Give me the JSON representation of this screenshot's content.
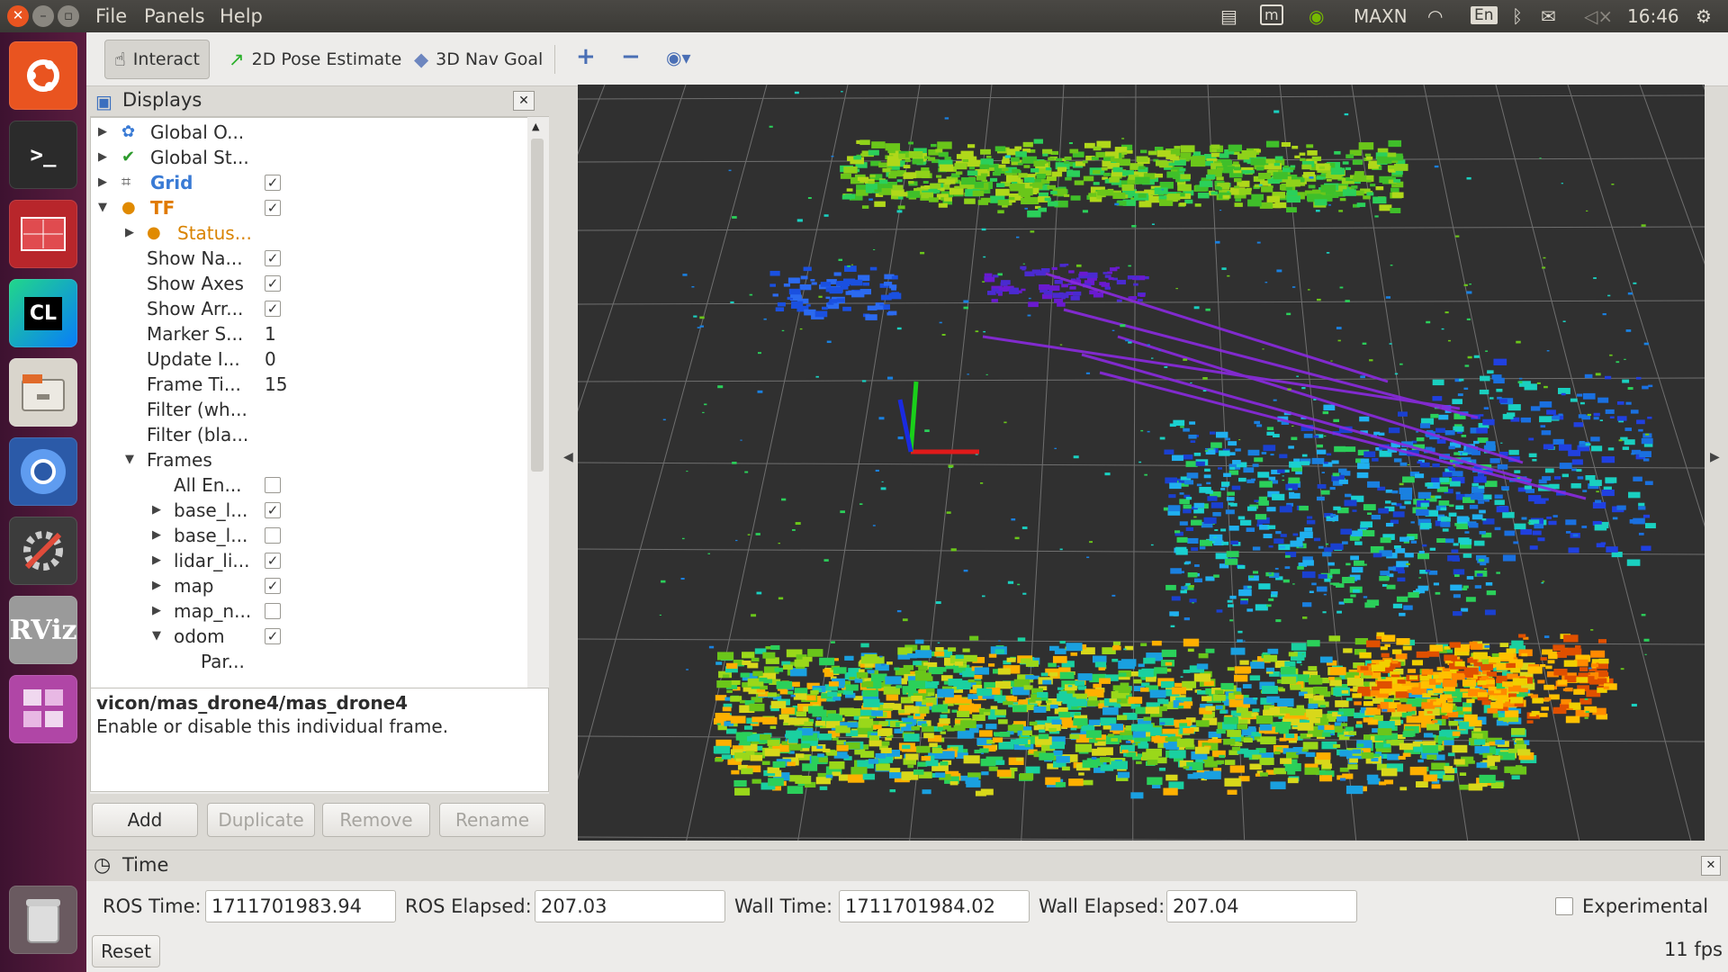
{
  "menubar": {
    "items": [
      "File",
      "Panels",
      "Help"
    ]
  },
  "tray": {
    "power_mode": "MAXN",
    "lang": "En",
    "clock": "16:46"
  },
  "launcher": {
    "items": [
      "ubuntu-logo",
      "terminal",
      "system-monitor",
      "clion",
      "file-manager",
      "chromium",
      "settings",
      "rviz",
      "workspace-switcher",
      "trash"
    ],
    "labels": {
      "clion": "CL",
      "rviz": "RViz"
    }
  },
  "toolbar": {
    "interact": "Interact",
    "pose_estimate": "2D Pose Estimate",
    "nav_goal": "3D Nav Goal"
  },
  "displays": {
    "title": "Displays",
    "tree": [
      {
        "label": "Global O...",
        "checkbox": null
      },
      {
        "label": "Global St...",
        "checkbox": null
      },
      {
        "label": "Grid",
        "checkbox": true
      },
      {
        "label": "TF",
        "checkbox": true
      },
      {
        "label": "Status...",
        "checkbox": null
      },
      {
        "label": "Show Na...",
        "checkbox": true
      },
      {
        "label": "Show Axes",
        "checkbox": true
      },
      {
        "label": "Show Arr...",
        "checkbox": true
      },
      {
        "label": "Marker S...",
        "value": "1"
      },
      {
        "label": "Update I...",
        "value": "0"
      },
      {
        "label": "Frame Ti...",
        "value": "15"
      },
      {
        "label": "Filter (wh...",
        "value": ""
      },
      {
        "label": "Filter (bla...",
        "value": ""
      },
      {
        "label": "Frames",
        "checkbox": null
      },
      {
        "label": "All En...",
        "checkbox": false
      },
      {
        "label": "base_l...",
        "checkbox": true
      },
      {
        "label": "base_l...",
        "checkbox": false
      },
      {
        "label": "lidar_li...",
        "checkbox": true
      },
      {
        "label": "map",
        "checkbox": true
      },
      {
        "label": "map_n...",
        "checkbox": false
      },
      {
        "label": "odom",
        "checkbox": true
      },
      {
        "label": "Par...",
        "checkbox": null
      }
    ],
    "help_title": "vicon/mas_drone4/mas_drone4",
    "help_desc": "Enable or disable this individual frame.",
    "buttons": {
      "add": "Add",
      "duplicate": "Duplicate",
      "remove": "Remove",
      "rename": "Rename"
    }
  },
  "time": {
    "title": "Time",
    "ros_time_label": "ROS Time:",
    "ros_time": "1711701983.94",
    "ros_elapsed_label": "ROS Elapsed:",
    "ros_elapsed": "207.03",
    "wall_time_label": "Wall Time:",
    "wall_time": "1711701984.02",
    "wall_elapsed_label": "Wall Elapsed:",
    "wall_elapsed": "207.04",
    "experimental_label": "Experimental",
    "reset": "Reset",
    "fps": "11 fps"
  }
}
